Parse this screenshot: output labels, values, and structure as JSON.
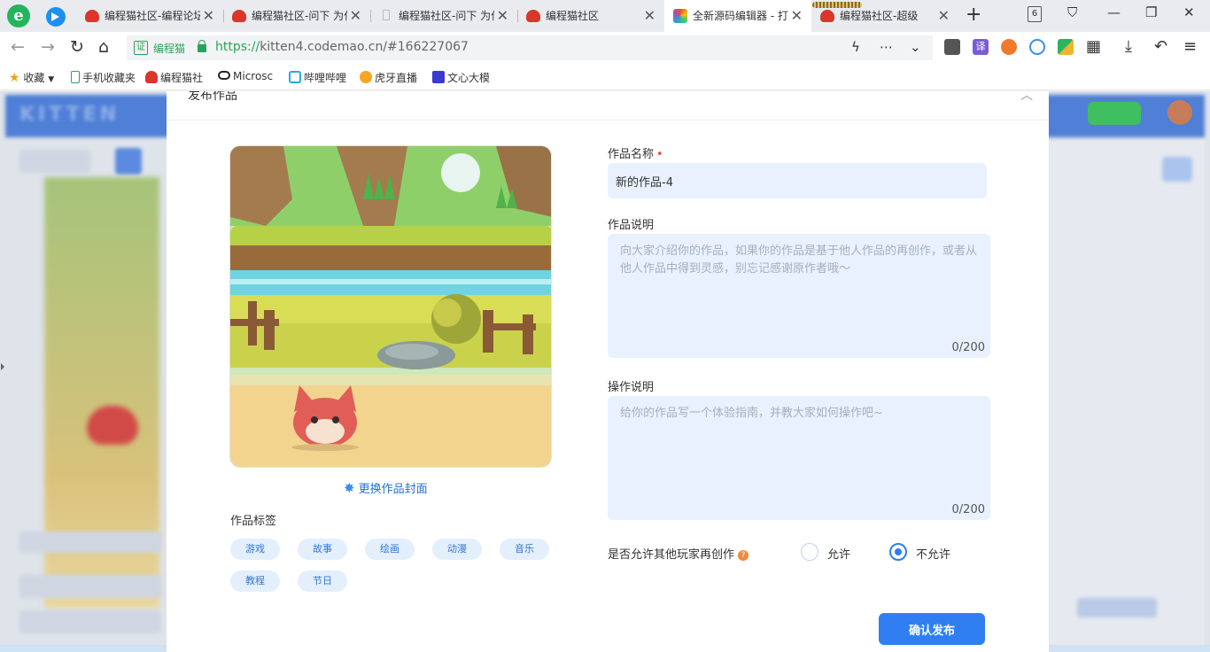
{
  "browser": {
    "logo_glyph": "e",
    "tabs": [
      {
        "title": "编程猫社区-编程论坛"
      },
      {
        "title": "编程猫社区-问下 为什"
      },
      {
        "title": "编程猫社区-问下 为什"
      },
      {
        "title": "编程猫社区"
      },
      {
        "title": "全新源码编辑器 - 打"
      },
      {
        "title": "编程猫社区-超级"
      }
    ],
    "tab_close_glyph": "✕",
    "new_tab_glyph": "+",
    "tab_count": "6",
    "address": {
      "site_label": "编程猫",
      "cert_glyph": "证",
      "url_scheme": "https://",
      "url_host": "kitten4.codemao.cn",
      "url_path": "/#166227067"
    },
    "bookmarks": [
      {
        "label": "收藏",
        "icon": "star-icon"
      },
      {
        "label": "手机收藏夹",
        "icon": "phone-icon"
      },
      {
        "label": "编程猫社",
        "icon": "codemao-icon"
      },
      {
        "label": "Microsc",
        "icon": "microsoft-icon"
      },
      {
        "label": "哔哩哔哩",
        "icon": "bilibili-icon"
      },
      {
        "label": "虎牙直播",
        "icon": "huya-icon"
      },
      {
        "label": "文心大模",
        "icon": "wenxin-icon"
      }
    ],
    "ext_translate_label": "译"
  },
  "background_app": {
    "brand": "KITTEN"
  },
  "modal": {
    "title": "发布作品",
    "cover_action": "更换作品封面",
    "tags_label": "作品标签",
    "tags": [
      "游戏",
      "故事",
      "绘画",
      "动漫",
      "音乐",
      "教程",
      "节日"
    ],
    "name_label": "作品名称",
    "required_mark": "•",
    "name_value": "新的作品-4",
    "desc_label": "作品说明",
    "desc_placeholder": "向大家介绍你的作品，如果你的作品是基于他人作品的再创作，或者从他人作品中得到灵感，别忘记感谢原作者哦～",
    "desc_counter": "0/200",
    "ops_label": "操作说明",
    "ops_placeholder": "给你的作品写一个体验指南，并教大家如何操作吧~",
    "ops_counter": "0/200",
    "remix_label": "是否允许其他玩家再创作",
    "remix_help_glyph": "?",
    "remix_options": [
      {
        "label": "允许",
        "checked": false
      },
      {
        "label": "不允许",
        "checked": true
      }
    ],
    "publish_button": "确认发布"
  },
  "colors": {
    "accent": "#2f7ff3",
    "input_bg": "#e8f1fd",
    "tag_bg": "#e4effc",
    "required": "#e54d42",
    "secure_green": "#2aa35a"
  }
}
